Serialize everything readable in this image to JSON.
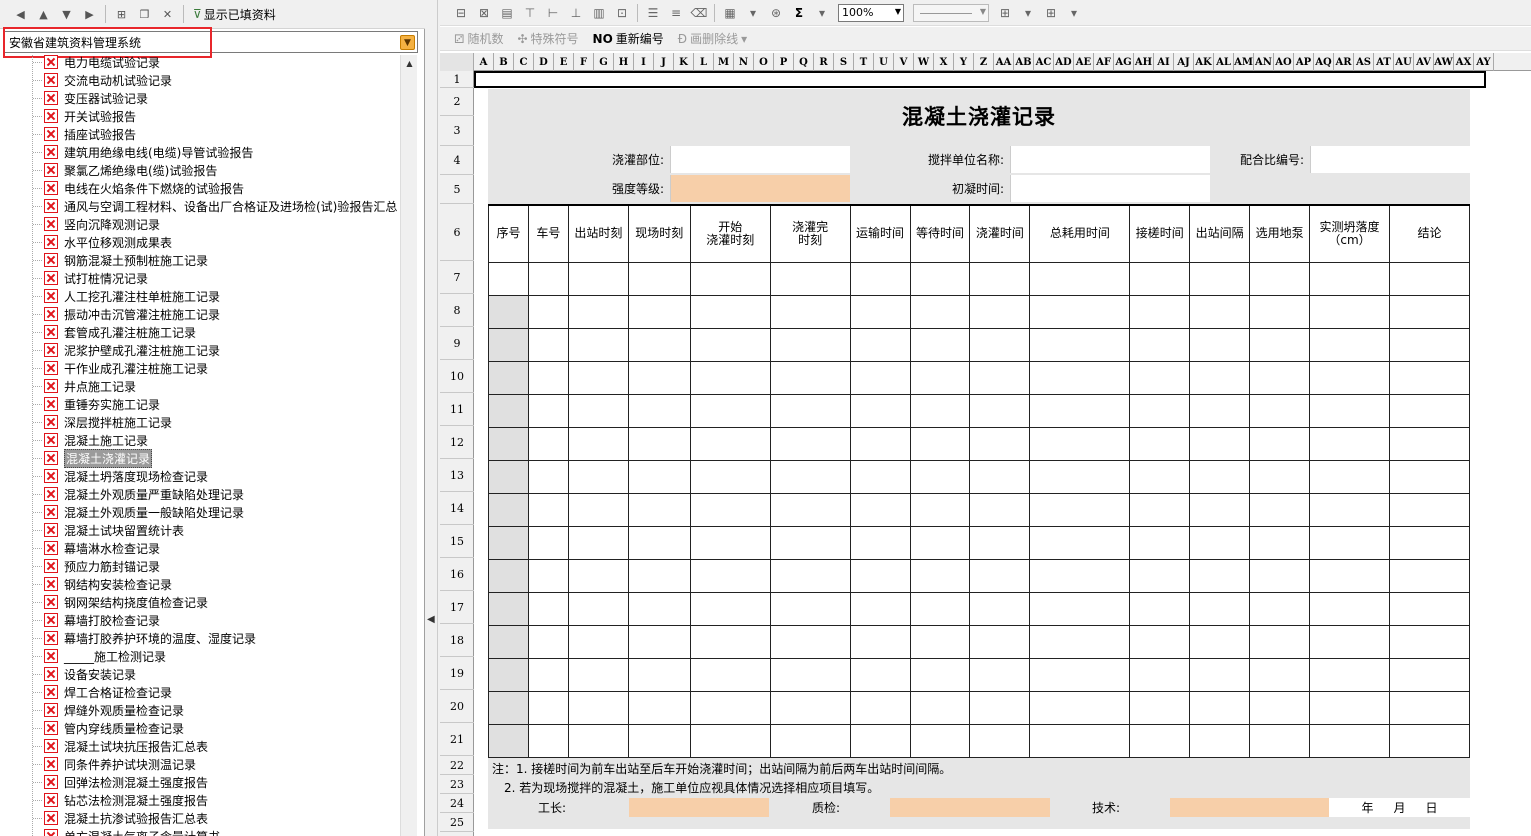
{
  "left_toolbar": {
    "show_filled_label": "显示已填资料"
  },
  "system_combo": {
    "value": "安徽省建筑资料管理系统"
  },
  "tree": {
    "items": [
      "电力电缆试验记录",
      "交流电动机试验记录",
      "变压器试验记录",
      "开关试验报告",
      "插座试验报告",
      "建筑用绝缘电线(电缆)导管试验报告",
      "聚氯乙烯绝缘电(缆)试验报告",
      "电线在火焰条件下燃烧的试验报告",
      "通风与空调工程材料、设备出厂合格证及进场检(试)验报告汇总",
      "竖向沉降观测记录",
      "水平位移观测成果表",
      "钢筋混凝土预制桩施工记录",
      "试打桩情况记录",
      "人工挖孔灌注柱单桩施工记录",
      "振动冲击沉管灌注桩施工记录",
      "套管成孔灌注桩施工记录",
      "泥浆护壁成孔灌注桩施工记录",
      "干作业成孔灌注桩施工记录",
      "井点施工记录",
      "重锤夯实施工记录",
      "深层搅拌桩施工记录",
      "混凝土施工记录",
      "混凝土浇灌记录",
      "混凝土坍落度现场检查记录",
      "混凝土外观质量严重缺陷处理记录",
      "混凝土外观质量一般缺陷处理记录",
      "混凝土试块留置统计表",
      "幕墙淋水检查记录",
      "预应力筋封锚记录",
      "钢结构安装检查记录",
      "钢网架结构挠度值检查记录",
      "幕墙打胶检查记录",
      "幕墙打胶养护环境的温度、湿度记录",
      "_____施工检测记录",
      "设备安装记录",
      "焊工合格证检查记录",
      "焊缝外观质量检查记录",
      "管内穿线质量检查记录",
      "混凝土试块抗压报告汇总表",
      "同条件养护试块测温记录",
      "回弹法检测混凝土强度报告",
      "钻芯法检测混凝土强度报告",
      "混凝土抗渗试验报告汇总表",
      "单方混凝土气离子含量计算书"
    ],
    "selected_index": 22
  },
  "right_toolbar": {
    "zoom": "100%",
    "sum_icon": "Σ",
    "random_num": "随机数",
    "special_symbol": "特殊符号",
    "renumber": "重新编号",
    "strikethrough": "画删除线"
  },
  "columns": [
    "A",
    "B",
    "C",
    "D",
    "E",
    "F",
    "G",
    "H",
    "I",
    "J",
    "K",
    "L",
    "M",
    "N",
    "O",
    "P",
    "Q",
    "R",
    "S",
    "T",
    "U",
    "V",
    "W",
    "X",
    "Y",
    "Z",
    "AA",
    "AB",
    "AC",
    "AD",
    "AE",
    "AF",
    "AG",
    "AH",
    "AI",
    "AJ",
    "AK",
    "AL",
    "AM",
    "AN",
    "AO",
    "AP",
    "AQ",
    "AR",
    "AS",
    "AT",
    "AU",
    "AV",
    "AW",
    "AX",
    "AY"
  ],
  "rows": [
    "1",
    "2",
    "3",
    "4",
    "5",
    "6",
    "7",
    "8",
    "9",
    "10",
    "11",
    "12",
    "13",
    "14",
    "15",
    "16",
    "17",
    "18",
    "19",
    "20",
    "21",
    "22",
    "23",
    "24",
    "25"
  ],
  "form": {
    "title": "混凝土浇灌记录",
    "pour_location": "浇灌部位:",
    "mixing_unit": "搅拌单位名称:",
    "mix_ratio_no": "配合比编号:",
    "strength_grade": "强度等级:",
    "initial_set_time": "初凝时间:",
    "headers": [
      "序号",
      "车号",
      "出站时刻",
      "现场时刻",
      "开始\n浇灌时刻",
      "浇灌完\n时刻",
      "运输时间",
      "等待时间",
      "浇灌时间",
      "总耗用时间",
      "接槎时间",
      "出站间隔",
      "选用地泵",
      "实测坍落度\n（cm）",
      "结论"
    ],
    "note1": "注：1. 接槎时间为前车出站至后车开始浇灌时间；出站间隔为前后两车出站时间间隔。",
    "note2": "2. 若为现场搅拌的混凝土，施工单位应视具体情况选择相应项目填写。",
    "foreman": "工长:",
    "inspector": "质检:",
    "technician": "技术:",
    "date_year": "年",
    "date_month": "月",
    "date_day": "日"
  },
  "colors": {
    "required_field": "#f7cfa9",
    "selection": "#9b9b9b",
    "highlight_box": "#e8262b"
  }
}
